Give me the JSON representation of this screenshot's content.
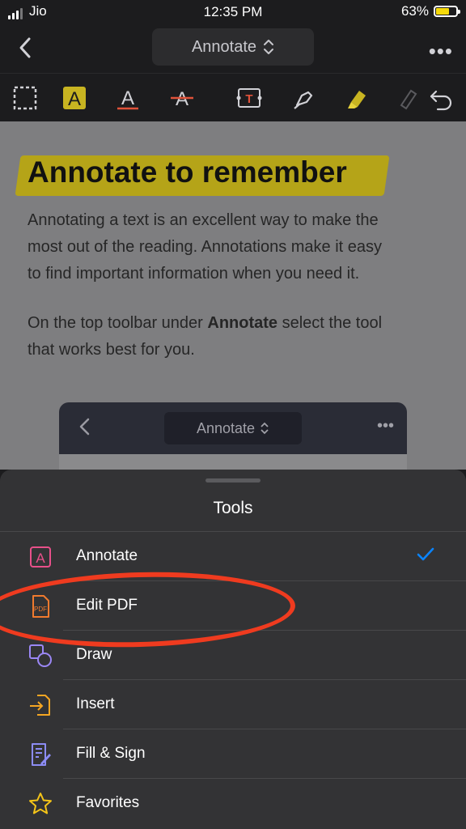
{
  "status_bar": {
    "carrier": "Jio",
    "time": "12:35 PM",
    "battery": "63%"
  },
  "nav": {
    "title": "Annotate",
    "more": "•••"
  },
  "toolbar": {
    "tools": [
      "select-area",
      "highlight-text",
      "underline-text",
      "strikethrough-text",
      "add-text-box",
      "pen",
      "highlighter",
      "eraser",
      "undo"
    ]
  },
  "document": {
    "heading": "Annotate to remember",
    "paragraph1_lines": [
      "Annotating a text is an excellent way to make the",
      "most out of the reading. Annotations make it easy",
      "to find important information when you need it."
    ],
    "paragraph2_line1_prefix": "On the top toolbar under ",
    "paragraph2_bold": "Annotate",
    "paragraph2_line1_suffix": " select the tool",
    "paragraph2_line2": "that works best for you.",
    "mini_title": "Annotate",
    "mini_more": "•••",
    "highlight_color": "#b5a418"
  },
  "sheet": {
    "title": "Tools",
    "items": [
      {
        "label": "Annotate",
        "icon": "annotate-icon",
        "selected": true
      },
      {
        "label": "Edit PDF",
        "icon": "edit-pdf-icon",
        "selected": false
      },
      {
        "label": "Draw",
        "icon": "draw-icon",
        "selected": false
      },
      {
        "label": "Insert",
        "icon": "insert-icon",
        "selected": false
      },
      {
        "label": "Fill & Sign",
        "icon": "fill-sign-icon",
        "selected": false
      },
      {
        "label": "Favorites",
        "icon": "star-icon",
        "selected": false
      }
    ],
    "check_color": "#0a84ff",
    "circle_color": "#ef3b1f"
  }
}
